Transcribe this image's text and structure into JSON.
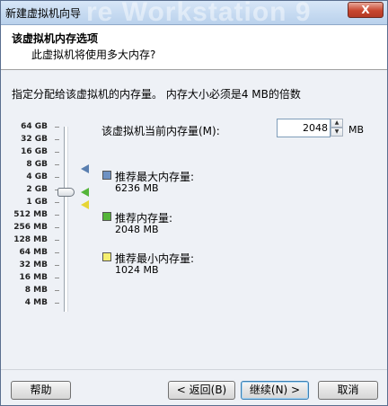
{
  "window": {
    "title": "新建虚拟机向导",
    "watermark": "re Workstation 9",
    "close": "X"
  },
  "header": {
    "title": "该虚拟机内存选项",
    "subtitle": "此虚拟机将使用多大内存?"
  },
  "description": "指定分配给该虚拟机的内存量。 内存大小必须是4 MB的倍数",
  "memory": {
    "label": "该虚拟机当前内存量(M):",
    "value": "2048",
    "unit": "MB"
  },
  "scale_labels": [
    "64 GB",
    "32 GB",
    "16 GB",
    "8 GB",
    "4 GB",
    "2 GB",
    "1 GB",
    "512 MB",
    "256 MB",
    "128 MB",
    "64 MB",
    "32 MB",
    "16 MB",
    "8 MB",
    "4 MB"
  ],
  "legend": {
    "max": {
      "title": "推荐最大内存量:",
      "value": "6236 MB",
      "color": "#5a7fb0"
    },
    "recommended": {
      "title": "推荐内存量:",
      "value": "2048 MB",
      "color": "#55b53a"
    },
    "min": {
      "title": "推荐最小内存量:",
      "value": "1024 MB",
      "color": "#f5ef70"
    }
  },
  "buttons": {
    "help": "帮助",
    "back": "< 返回(B)",
    "next": "继续(N) >",
    "cancel": "取消"
  }
}
